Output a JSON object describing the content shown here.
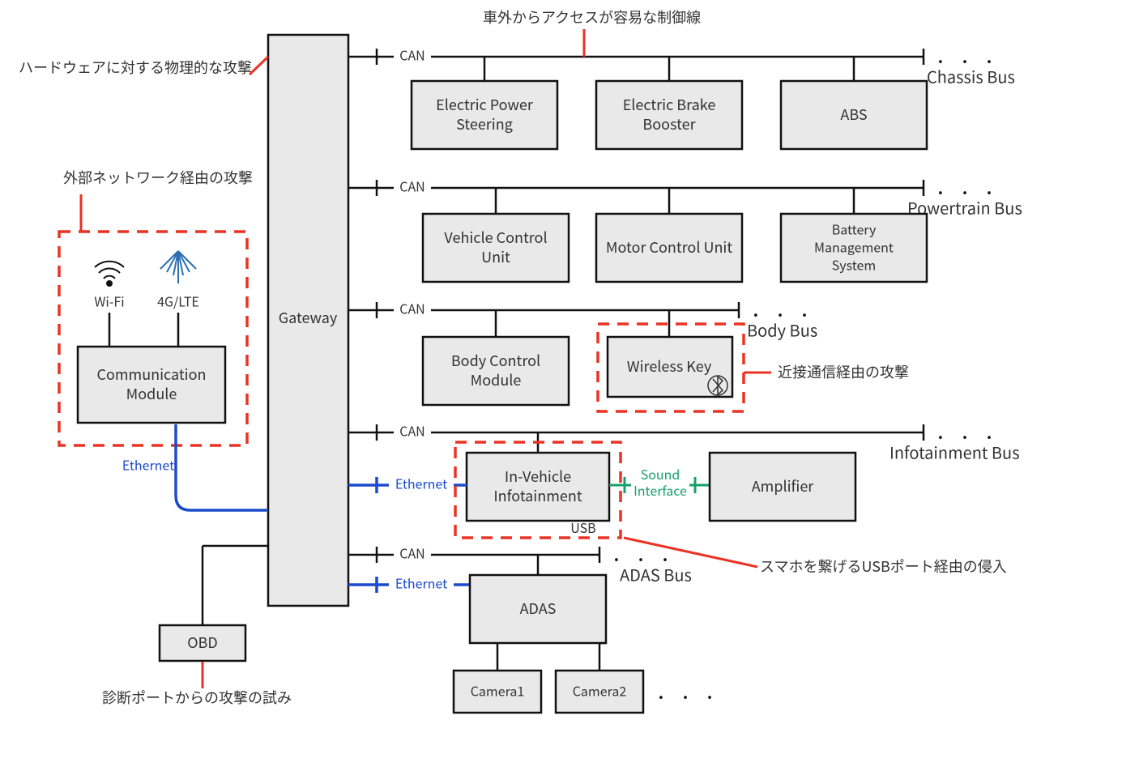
{
  "gateway": "Gateway",
  "comm_module_l1": "Communication",
  "comm_module_l2": "Module",
  "wifi": "Wi-Fi",
  "lte": "4G/LTE",
  "obd": "OBD",
  "ethernet": "Ethernet",
  "can": "CAN",
  "usb": "USB",
  "sound_l1": "Sound",
  "sound_l2": "Interface",
  "buses": {
    "chassis": {
      "name": "Chassis Bus",
      "nodes": {
        "eps_l1": "Electric Power",
        "eps_l2": "Steering",
        "ebb_l1": "Electric Brake",
        "ebb_l2": "Booster",
        "abs": "ABS"
      }
    },
    "powertrain": {
      "name": "Powertrain Bus",
      "nodes": {
        "vcu_l1": "Vehicle Control",
        "vcu_l2": "Unit",
        "mcu": "Motor Control Unit",
        "bms_l1": "Battery",
        "bms_l2": "Management",
        "bms_l3": "System"
      }
    },
    "body": {
      "name": "Body Bus",
      "nodes": {
        "bcm_l1": "Body Control",
        "bcm_l2": "Module",
        "wk": "Wireless Key"
      }
    },
    "infotainment": {
      "name": "Infotainment Bus",
      "nodes": {
        "ivi_l1": "In-Vehicle",
        "ivi_l2": "Infotainment",
        "amp": "Amplifier"
      }
    },
    "adas": {
      "name": "ADAS Bus",
      "nodes": {
        "adas": "ADAS",
        "cam1": "Camera1",
        "cam2": "Camera2"
      }
    }
  },
  "annotations": {
    "hw_attack": "ハードウェアに対する物理的な攻撃",
    "ext_net_attack": "外部ネットワーク経由の攻撃",
    "ext_ctrl_line": "車外からアクセスが容易な制御線",
    "proximity_attack": "近接通信経由の攻撃",
    "usb_intrusion": "スマホを繋げるUSBポート経由の侵入",
    "diag_port_attack": "診断ポートからの攻撃の試み"
  },
  "dots": ". . ."
}
